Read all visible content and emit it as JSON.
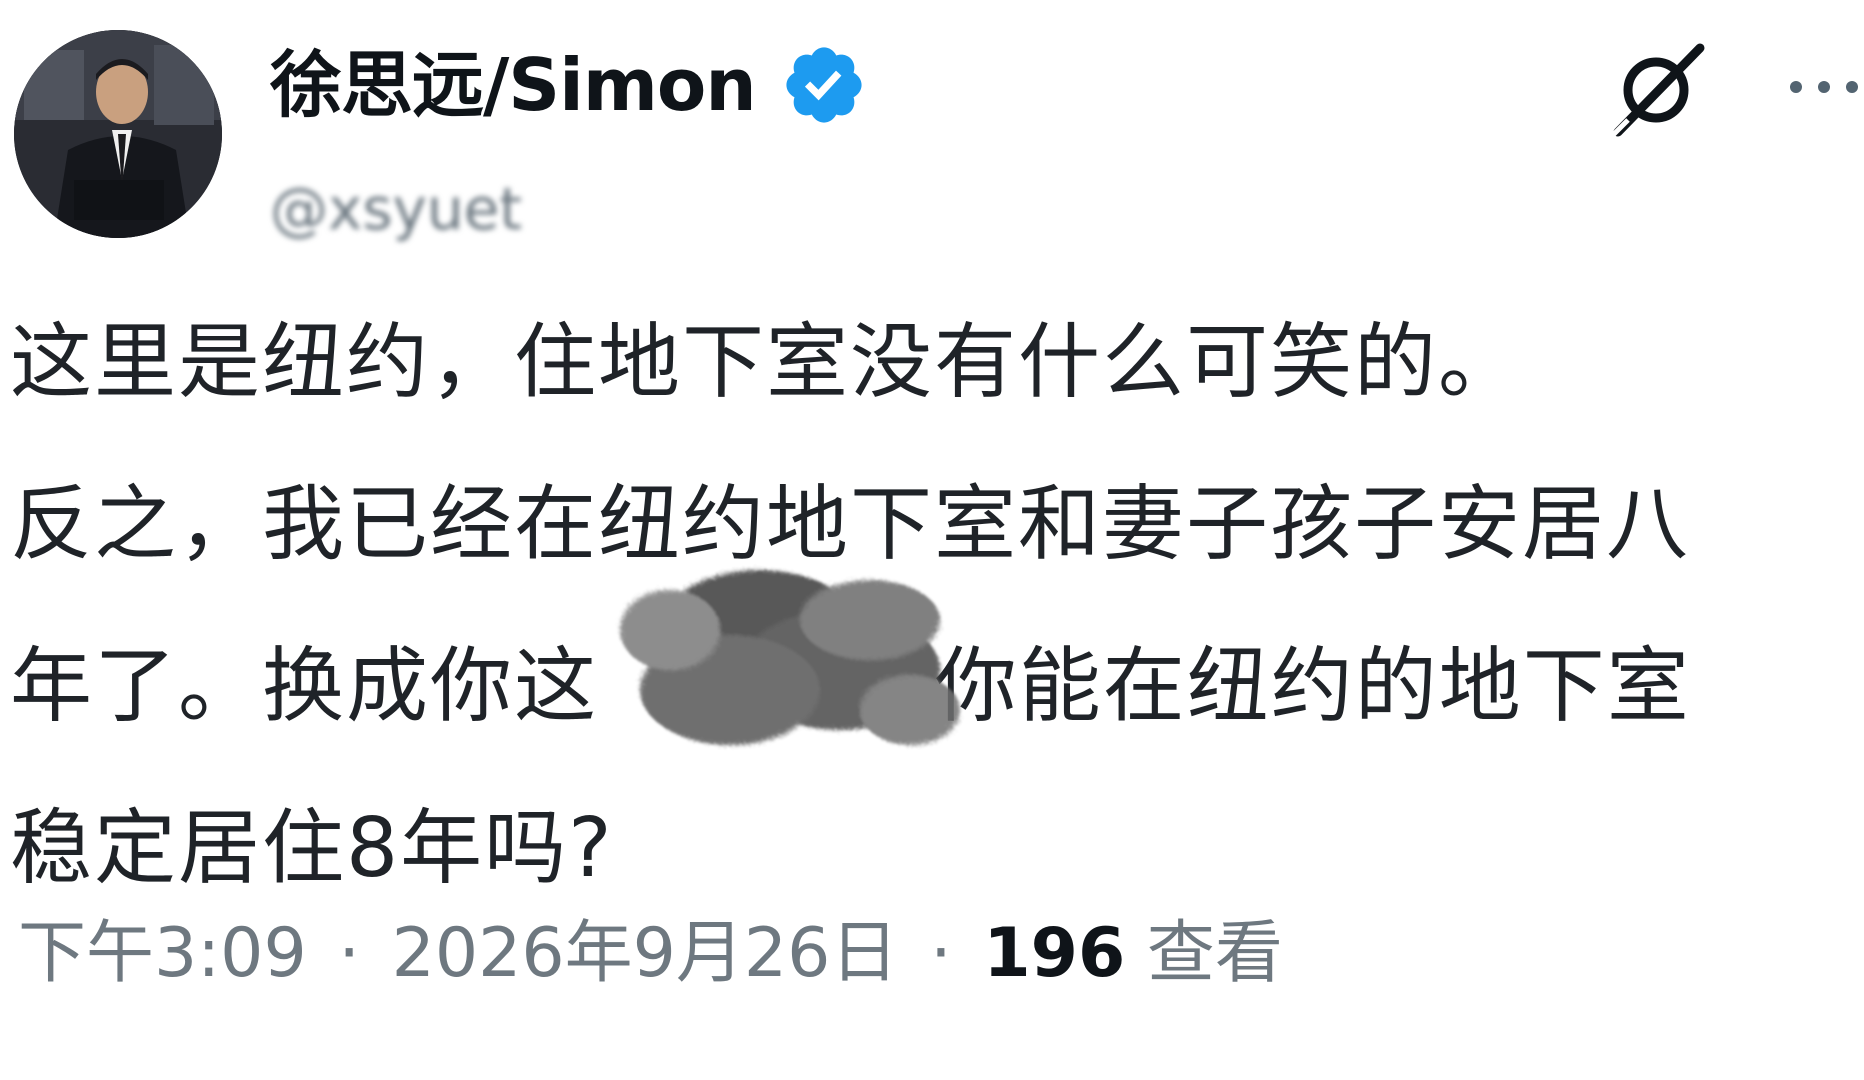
{
  "post": {
    "author": {
      "display_name": "徐思远/Simon",
      "handle": "@xsyuet",
      "verified": true,
      "verified_color": "#1d9bf0"
    },
    "actions": {
      "grok_icon": "grok-icon",
      "more_icon": "more-icon"
    },
    "text_lines": [
      "这里是纽约，住地下室没有什么可笑的。",
      "反之，我已经在纽约地下室和妻子孩子安居八",
      "年了。换成你这            你能在纽约的地下室",
      "稳定居住8年吗?"
    ],
    "time": "下午3:09",
    "date": "2026年9月26日",
    "separator": "·",
    "views_count": "196",
    "views_label": "查看"
  }
}
